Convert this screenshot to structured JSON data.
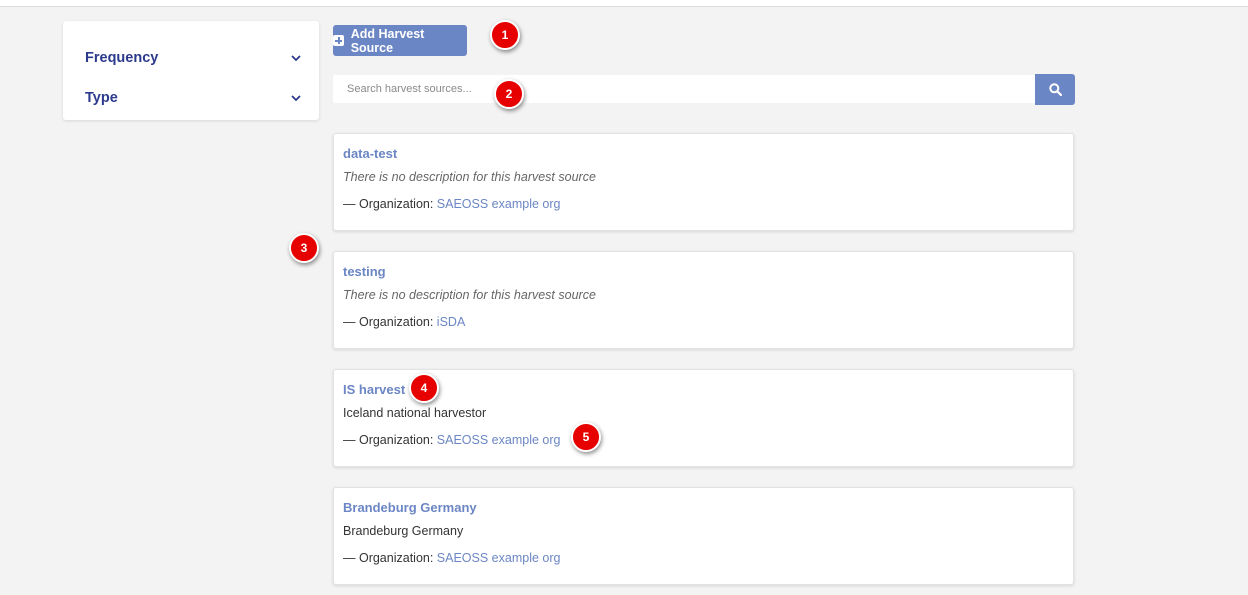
{
  "filters": [
    {
      "label": "Frequency"
    },
    {
      "label": "Type"
    }
  ],
  "add_button": {
    "label": "Add Harvest Source"
  },
  "search": {
    "placeholder": "Search harvest sources..."
  },
  "sources": [
    {
      "title": "data-test",
      "description": "There is no description for this harvest source",
      "description_empty": true,
      "org_prefix": "— Organization: ",
      "org": "SAEOSS example org"
    },
    {
      "title": "testing",
      "description": "There is no description for this harvest source",
      "description_empty": true,
      "org_prefix": "— Organization: ",
      "org": "iSDA"
    },
    {
      "title": "IS harvest",
      "description": "Iceland national harvestor",
      "description_empty": false,
      "org_prefix": "— Organization: ",
      "org": "SAEOSS example org"
    },
    {
      "title": "Brandeburg Germany",
      "description": "Brandeburg Germany",
      "description_empty": false,
      "org_prefix": "— Organization: ",
      "org": "SAEOSS example org"
    }
  ],
  "annotations": [
    "1",
    "2",
    "3",
    "4",
    "5"
  ],
  "colors": {
    "accent": "#6b86c4",
    "heading": "#2b3a8c",
    "badge": "#e60000",
    "background": "#f3f3f3"
  }
}
